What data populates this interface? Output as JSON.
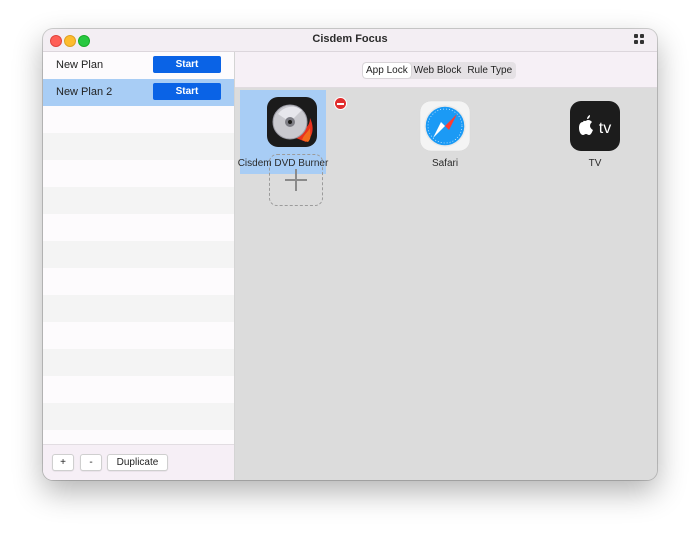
{
  "window": {
    "title": "Cisdem Focus"
  },
  "sidebar": {
    "plans": [
      {
        "name": "New Plan",
        "button": "Start",
        "selected": false
      },
      {
        "name": "New Plan 2",
        "button": "Start",
        "selected": true
      }
    ],
    "footer": {
      "add": "+",
      "remove": "-",
      "duplicate": "Duplicate"
    }
  },
  "main": {
    "tabs": [
      {
        "label": "App Lock",
        "active": true
      },
      {
        "label": "Web Block",
        "active": false
      },
      {
        "label": "Rule Type",
        "active": false
      }
    ],
    "apps": [
      {
        "name": "Cisdem DVD Burner",
        "icon": "dvd-burner-icon",
        "selected": true
      },
      {
        "name": "Safari",
        "icon": "safari-icon",
        "selected": false
      },
      {
        "name": "TV",
        "icon": "apple-tv-icon",
        "selected": false
      }
    ],
    "tv_icon_text": "tv"
  },
  "colors": {
    "accent": "#0a63e6",
    "selection": "#a8cdf5",
    "remove": "#e02d2d"
  }
}
